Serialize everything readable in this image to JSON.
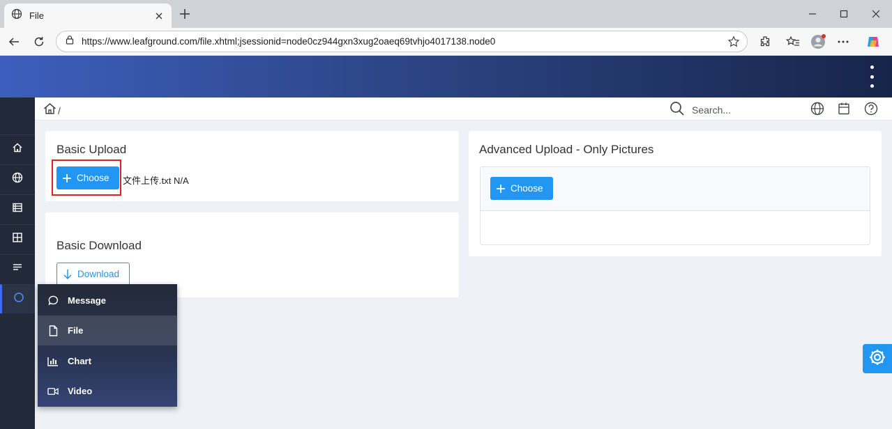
{
  "browser": {
    "tab_title": "File",
    "url": "https://www.leafground.com/file.xhtml;jsessionid=node0cz944gxn3xug2oaeq69tvhjo4017138.node0"
  },
  "breadcrumb": {
    "separator": "/"
  },
  "search": {
    "placeholder": "Search..."
  },
  "basic_upload": {
    "title": "Basic Upload",
    "choose_label": "Choose",
    "file_name": "文件上传.txt N/A"
  },
  "basic_download": {
    "title": "Basic Download",
    "download_label": "Download"
  },
  "advanced_upload": {
    "title": "Advanced Upload - Only Pictures",
    "choose_label": "Choose"
  },
  "submenu": {
    "items": [
      {
        "label": "Message",
        "icon": "chat-icon"
      },
      {
        "label": "File",
        "icon": "file-icon"
      },
      {
        "label": "Chart",
        "icon": "chart-icon"
      },
      {
        "label": "Video",
        "icon": "video-icon"
      }
    ]
  },
  "colors": {
    "primary": "#2196f3",
    "sidebar": "#222a3a",
    "header_start": "#3d5ebd",
    "header_end": "#17254a",
    "highlight": "#e02020"
  }
}
